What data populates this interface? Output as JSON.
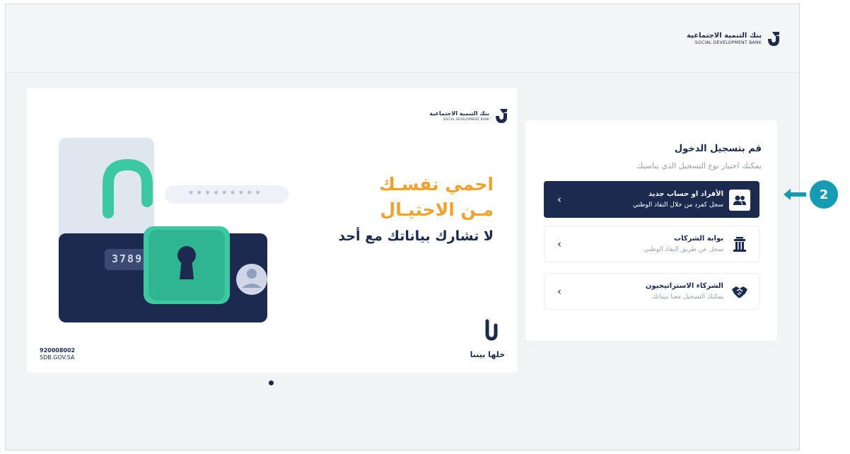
{
  "header": {
    "logo_ar": "بنك التنمية الاجتماعية",
    "logo_en": "SOCIAL DEVELOPMENT BANK"
  },
  "banner": {
    "logo_ar": "بنك التنمية الاجتماعية",
    "logo_en": "SOCIAL DEVELOPMENT BANK",
    "headline_1": "احمي نفسـك",
    "headline_2": "مـن الاحتيـال",
    "headline_3": "لا تشارك بياناتك مع أحد",
    "password_mask": "*********",
    "card_digits": "3789",
    "phone": "920008002",
    "website": "SDB.GOV.SA",
    "slogan": "خلها بيننا"
  },
  "login": {
    "title": "قم بتسجيل الدخول",
    "subtitle": "يمكنك اختيار نوع التسجيل الذي يناسبك",
    "options": [
      {
        "title": "الأفراد او حساب جديد",
        "desc": "سجل كفرد من خلال النفاذ الوطني",
        "icon": "users-icon",
        "active": true
      },
      {
        "title": "بوابة الشركات",
        "desc": "سجل عن طريق النفاذ الوطني",
        "icon": "building-icon",
        "active": false
      },
      {
        "title": "الشركاء الاستراتيجيون",
        "desc": "يمكنك التسجيل معنا بييناتك",
        "icon": "handshake-icon",
        "active": false
      }
    ]
  },
  "annotation": {
    "step": "2"
  },
  "colors": {
    "navy": "#1d2a4f",
    "accent_orange": "#f0a22e",
    "teal": "#169bb5",
    "lock_green": "#3cc8a0"
  }
}
